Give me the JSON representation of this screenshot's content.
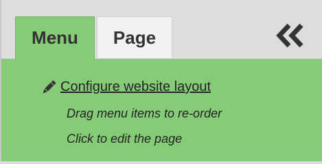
{
  "tabs": {
    "menu_label": "Menu",
    "page_label": "Page"
  },
  "collapse": {
    "icon": "double-chevron-left-icon"
  },
  "content": {
    "configure_label": "Configure website layout",
    "configure_icon": "pencil-icon",
    "hint_drag": "Drag menu items to re-order",
    "hint_click": "Click to edit the page"
  },
  "colors": {
    "active_tab": "#86cb78",
    "inactive_tab": "#f2f2f2",
    "background": "#dedcde",
    "text": "#333333"
  }
}
